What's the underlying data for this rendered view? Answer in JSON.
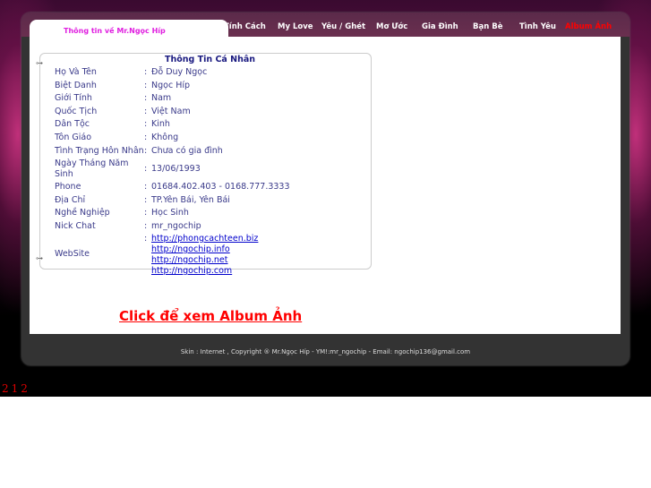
{
  "tab_title": "Thông tin về Mr.Ngọc Híp",
  "nav": [
    "Tính Cách",
    "My Love",
    "Yêu / Ghét",
    "Mơ Ước",
    "Gia Đình",
    "Bạn Bè",
    "Tình Yêu",
    "Album Ảnh"
  ],
  "box_title": "Thông Tin Cá Nhân",
  "rows": [
    {
      "label": "Họ Và Tên",
      "value": "Đỗ Duy Ngọc"
    },
    {
      "label": "Biệt Danh",
      "value": "Ngọc Híp"
    },
    {
      "label": "Giới Tính",
      "value": "Nam"
    },
    {
      "label": "Quốc Tịch",
      "value": "Việt Nam"
    },
    {
      "label": "Dân Tộc",
      "value": "Kinh"
    },
    {
      "label": "Tôn Giáo",
      "value": "Không"
    },
    {
      "label": "Tình Trạng Hôn Nhân",
      "value": "Chưa có gia đình"
    },
    {
      "label": "Ngày Tháng Năm Sinh",
      "value": "13/06/1993"
    },
    {
      "label": "Phone",
      "value": "01684.402.403 - 0168.777.3333"
    },
    {
      "label": "Địa Chỉ",
      "value": "TP.Yên Bái, Yên Bái"
    },
    {
      "label": "Nghề Nghiệp",
      "value": "Học Sinh"
    },
    {
      "label": "Nick Chat",
      "value": "mr_ngochip"
    }
  ],
  "website": {
    "label": "WebSite",
    "links": [
      "http://phongcachteen.biz",
      "http://ngochip.info",
      "http://ngochip.net",
      "http://ngochip.com"
    ]
  },
  "colon": ":",
  "album_link": "Click để xem Album Ảnh",
  "footer": "Skin : Internet , Copyright ® Mr.Ngọc Híp - YM!:mr_ngochip - Email: ngochip136@gmail.com",
  "counter": "212"
}
